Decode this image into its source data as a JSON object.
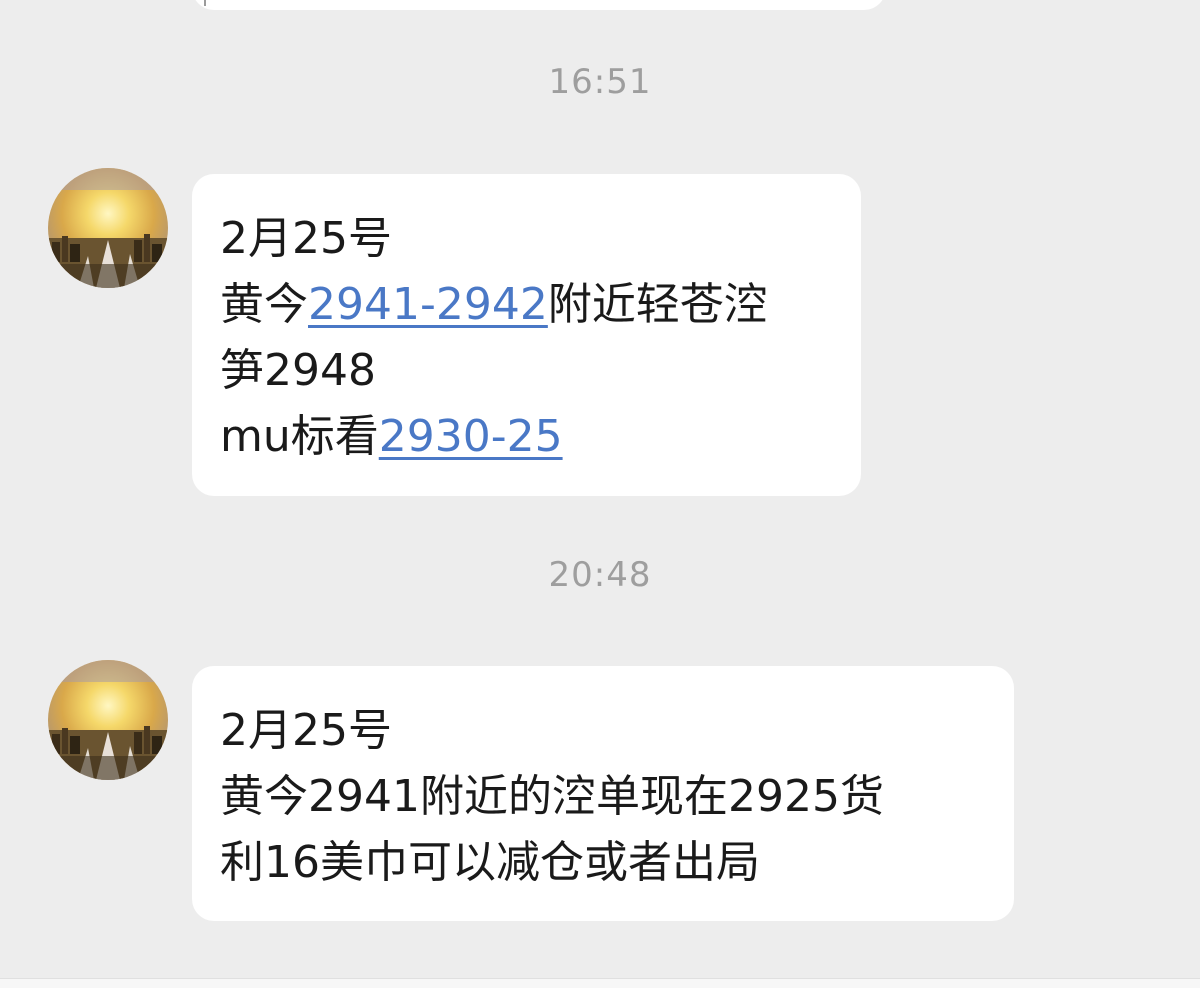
{
  "chat": {
    "messages": [
      {
        "time": "16:51",
        "lines": [
          {
            "text": "2月25号"
          },
          {
            "before": "黄今",
            "link": "2941-2942",
            "after": "附近轻苍涳"
          },
          {
            "text": "笋2948"
          },
          {
            "before": "mu标看",
            "link": "2930-25",
            "after": ""
          }
        ]
      },
      {
        "time": "20:48",
        "lines": [
          {
            "text": "2月25号"
          },
          {
            "text": "黄今2941附近的涳单现在2925货"
          },
          {
            "text": "利16美巾可以减仓或者出局"
          }
        ]
      }
    ]
  },
  "colors": {
    "background": "#EDEDED",
    "bubble": "#FFFFFF",
    "link": "#4A78C6",
    "timestamp": "#9E9E9E"
  },
  "icons": {
    "avatar": "sunset-city-avatar-icon"
  }
}
